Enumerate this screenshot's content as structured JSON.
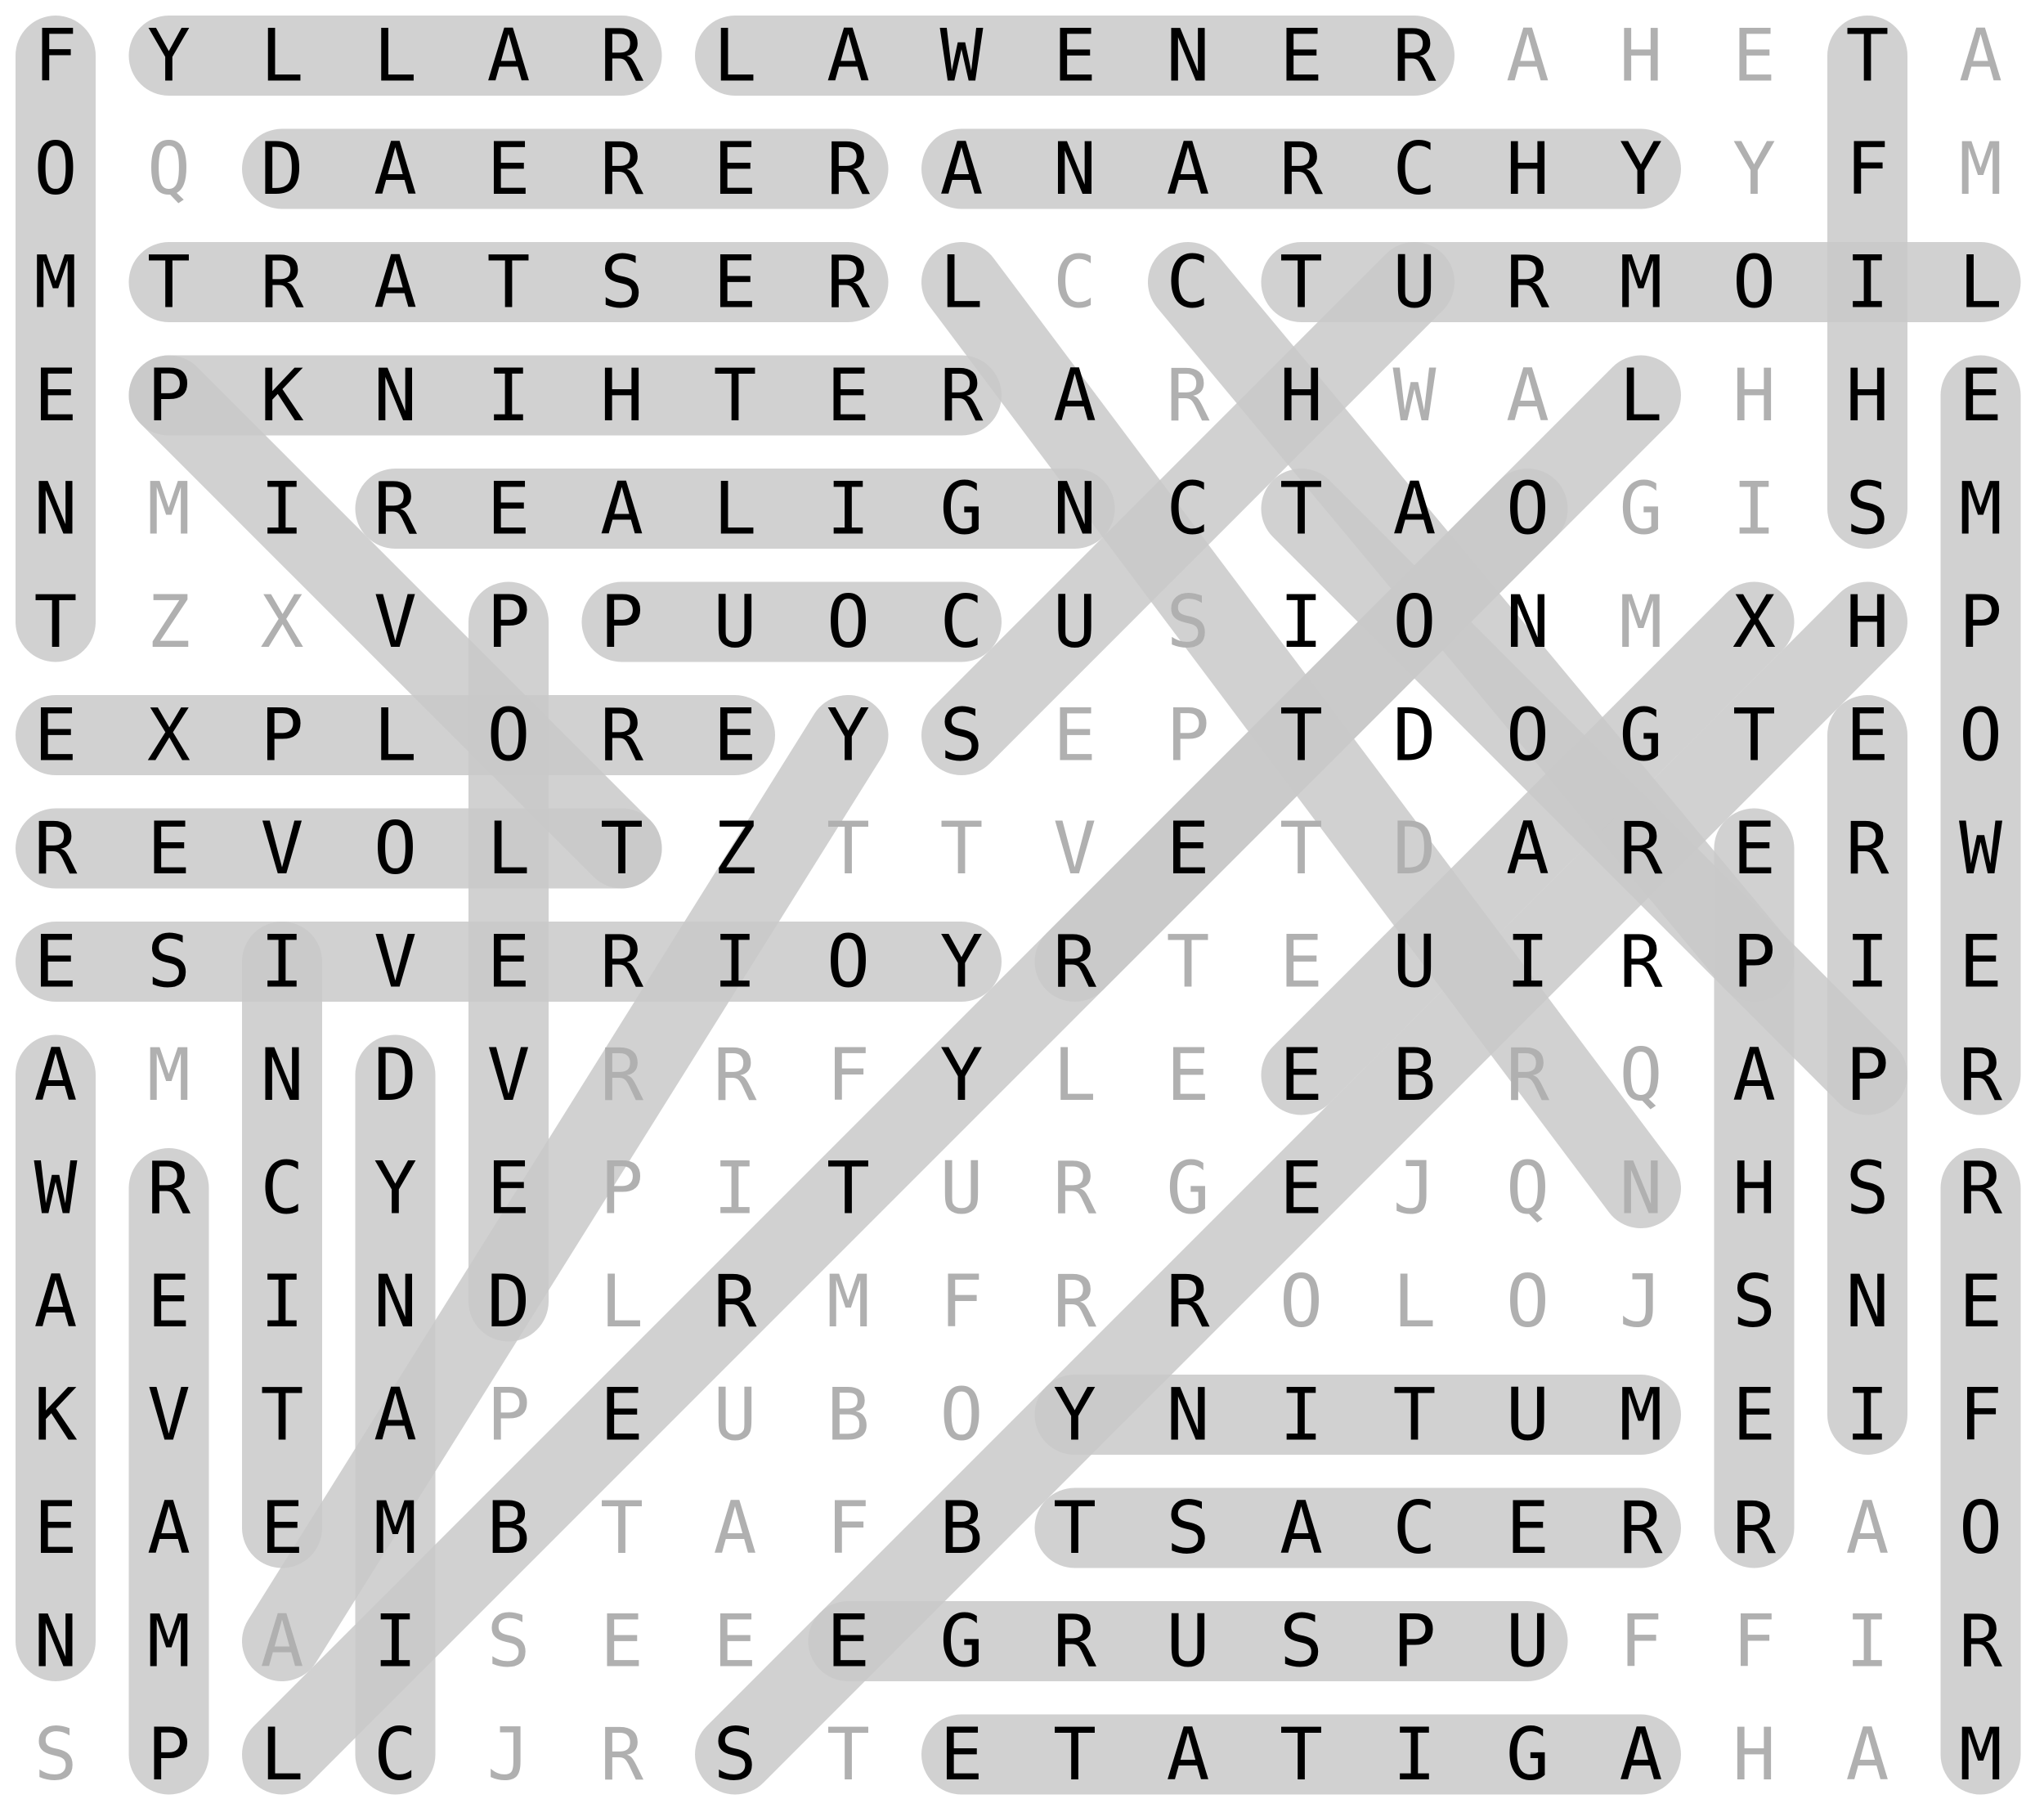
{
  "grid": [
    "FYLLARLAWENERAHETA",
    "OQDAERERANARCHYYFM",
    "MTRATSERLCCTURMOIL",
    "EPKNIHTERARHWALHHE",
    "NMIREALIGNCTAOGISM",
    "TZXVPPUOCUSIONMXHP",
    "EXPLOREYSEPTDOGTEO",
    "REVOLTZTTVETDARERW",
    "ESIVERIOYRTEUIRPIE",
    "AMNDVRRFYLEEBRQAPR",
    "WRCYEPITURGEJQNHSR",
    "AEINDLRMFRROLOJSNE",
    "KVTAPEUBOYNITUMEIF",
    "EAEMBTAFBTSACERRAO",
    "NMAISEEEGRUSPUFFIR",
    "SPLCJRSTETATIGAHAM"
  ],
  "found_words": [
    {
      "r1": 0,
      "c1": 1,
      "r2": 0,
      "c2": 5
    },
    {
      "r1": 0,
      "c1": 6,
      "r2": 0,
      "c2": 12
    },
    {
      "r1": 1,
      "c1": 2,
      "r2": 1,
      "c2": 7
    },
    {
      "r1": 1,
      "c1": 8,
      "r2": 1,
      "c2": 14
    },
    {
      "r1": 2,
      "c1": 1,
      "r2": 2,
      "c2": 7
    },
    {
      "r1": 2,
      "c1": 11,
      "r2": 2,
      "c2": 17
    },
    {
      "r1": 3,
      "c1": 1,
      "r2": 3,
      "c2": 8
    },
    {
      "r1": 4,
      "c1": 3,
      "r2": 4,
      "c2": 9
    },
    {
      "r1": 5,
      "c1": 5,
      "r2": 5,
      "c2": 8
    },
    {
      "r1": 6,
      "c1": 0,
      "r2": 6,
      "c2": 6
    },
    {
      "r1": 7,
      "c1": 0,
      "r2": 7,
      "c2": 5
    },
    {
      "r1": 8,
      "c1": 0,
      "r2": 8,
      "c2": 8
    },
    {
      "r1": 12,
      "c1": 9,
      "r2": 12,
      "c2": 14
    },
    {
      "r1": 13,
      "c1": 9,
      "r2": 13,
      "c2": 14
    },
    {
      "r1": 14,
      "c1": 7,
      "r2": 14,
      "c2": 13
    },
    {
      "r1": 15,
      "c1": 8,
      "r2": 15,
      "c2": 14
    },
    {
      "r1": 0,
      "c1": 0,
      "r2": 5,
      "c2": 0
    },
    {
      "r1": 9,
      "c1": 0,
      "r2": 14,
      "c2": 0
    },
    {
      "r1": 0,
      "c1": 16,
      "r2": 4,
      "c2": 16
    },
    {
      "r1": 3,
      "c1": 17,
      "r2": 9,
      "c2": 17
    },
    {
      "r1": 6,
      "c1": 16,
      "r2": 12,
      "c2": 16
    },
    {
      "r1": 10,
      "c1": 17,
      "r2": 15,
      "c2": 17
    },
    {
      "r1": 7,
      "c1": 15,
      "r2": 13,
      "c2": 15
    },
    {
      "r1": 10,
      "c1": 1,
      "r2": 15,
      "c2": 1
    },
    {
      "r1": 8,
      "c1": 2,
      "r2": 13,
      "c2": 2
    },
    {
      "r1": 9,
      "c1": 3,
      "r2": 15,
      "c2": 3
    },
    {
      "r1": 5,
      "c1": 4,
      "r2": 11,
      "c2": 4
    },
    {
      "r1": 3,
      "c1": 1,
      "r2": 7,
      "c2": 5
    },
    {
      "r1": 2,
      "c1": 8,
      "r2": 10,
      "c2": 14
    },
    {
      "r1": 2,
      "c1": 10,
      "r2": 8,
      "c2": 15
    },
    {
      "r1": 3,
      "c1": 14,
      "r2": 15,
      "c2": 2
    },
    {
      "r1": 5,
      "c1": 16,
      "r2": 15,
      "c2": 6
    },
    {
      "r1": 6,
      "c1": 7,
      "r2": 14,
      "c2": 2
    },
    {
      "r1": 4,
      "c1": 11,
      "r2": 9,
      "c2": 16
    },
    {
      "r1": 6,
      "c1": 8,
      "r2": 2,
      "c2": 12
    },
    {
      "r1": 8,
      "c1": 9,
      "r2": 4,
      "c2": 13
    },
    {
      "r1": 9,
      "c1": 11,
      "r2": 5,
      "c2": 15
    }
  ],
  "colors": {
    "highlight": "#c9c9c9",
    "found_letter": "#000000",
    "unused_letter": "#b0b0b0",
    "background": "#ffffff"
  }
}
